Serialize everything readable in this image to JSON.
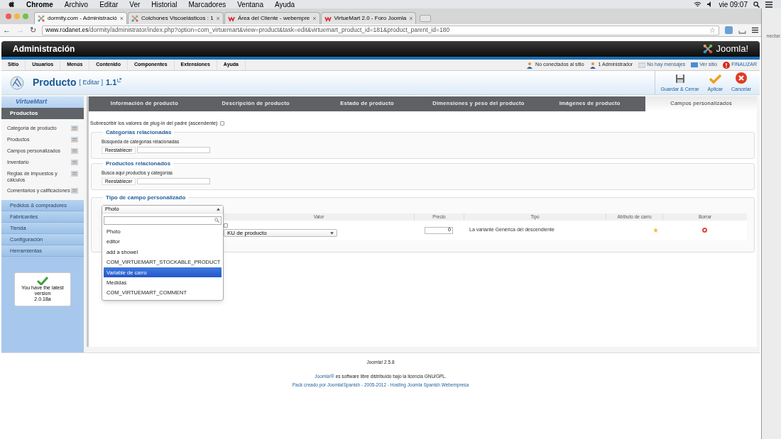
{
  "menubar": {
    "app": "Chrome",
    "menus": [
      "Archivo",
      "Editar",
      "Ver",
      "Historial",
      "Marcadores",
      "Ventana",
      "Ayuda"
    ],
    "clock": "vie 09:07"
  },
  "browser": {
    "tabs": [
      {
        "title": "dormity.com - Administració",
        "kind": "joomla",
        "selected": true
      },
      {
        "title": "Colchones Viscoelásticos : 1",
        "kind": "joomla",
        "selected": false
      },
      {
        "title": "Área del Cliente - webempre",
        "kind": "webempresa",
        "selected": false
      },
      {
        "title": "VirtueMart 2.0 - Foro Joomla",
        "kind": "webempresa",
        "selected": false
      }
    ],
    "close_glyph": "×",
    "nav": {
      "back": "←",
      "forward": "→",
      "reload": "↻",
      "bookmark": "☆"
    },
    "url_host": "www.rodanet.es",
    "url_path": "/dormity/administrator/index.php?option=com_virtuemart&view=product&task=edit&virtuemart_product_id=181&product_parent_id=180",
    "side_window_text": "nectar"
  },
  "header": {
    "title": "Administración",
    "logo": "Joomla!"
  },
  "admin_menu": [
    "Sitio",
    "Usuarios",
    "Menús",
    "Contenido",
    "Componentes",
    "Extensiones",
    "Ayuda"
  ],
  "status": [
    {
      "kind": "users",
      "label": "No conectados al sitio"
    },
    {
      "kind": "users",
      "label": "1 Administrador"
    },
    {
      "kind": "mail",
      "label": "No hay mensajes"
    },
    {
      "kind": "screen",
      "label": "Ver sitio"
    },
    {
      "kind": "alert",
      "label": "FINALIZAR"
    }
  ],
  "toolbar": {
    "title": "Producto",
    "edit": "[ Editar ]",
    "version": "1.1",
    "buttons": [
      {
        "kind": "save",
        "label": "Guardar & Cerrar"
      },
      {
        "kind": "apply",
        "label": "Aplicar"
      },
      {
        "kind": "cancel",
        "label": "Cancelar"
      }
    ]
  },
  "sidebar": {
    "logo": "VirtueMart",
    "section": "Productos",
    "items": [
      "Categoría de producto",
      "Productos",
      "Campos personalizados",
      "Inventario",
      "Reglas de impuestos y cálculos",
      "Comentarios y calificaciones"
    ],
    "groups": [
      "Pedidos & compradores",
      "Fabricantes",
      "Tienda",
      "Configuración",
      "Herramientas"
    ],
    "version_box": {
      "text": "You have the latest version",
      "version": "2.0.18a"
    }
  },
  "tabs": [
    {
      "label": "Información de producto",
      "selected": false
    },
    {
      "label": "Descripción de producto",
      "selected": false
    },
    {
      "label": "Estado de producto",
      "selected": false
    },
    {
      "label": "Dimensiones y peso del producto",
      "selected": false
    },
    {
      "label": "Imágenes de producto",
      "selected": false
    },
    {
      "label": "Campos personalizados",
      "selected": true
    }
  ],
  "override": {
    "label": "Sobrescribir los valores de plug-in del padre (ascendente)",
    "checked": false
  },
  "related": [
    {
      "legend": "Categorías relacionadas",
      "hint": "Búsqueda de categorías relacionadas",
      "button": "Reestablecer"
    },
    {
      "legend": "Productos relacionados",
      "hint": "Busca aquí productos y categorías",
      "button": "Reestablecer"
    }
  ],
  "custom_type": {
    "legend": "Tipo de campo personalizado",
    "select_value": "Photo",
    "options": [
      {
        "label": "Photo",
        "selected": false
      },
      {
        "label": "editor",
        "selected": false
      },
      {
        "label": "add a showel",
        "selected": false
      },
      {
        "label": "COM_VIRTUEMART_STOCKABLE_PRODUCT",
        "selected": false
      },
      {
        "label": "Variable de carro",
        "selected": true
      },
      {
        "label": "Medidas",
        "selected": false
      },
      {
        "label": "COM_VIRTUEMART_COMMENT",
        "selected": false
      }
    ],
    "columns": [
      "Valor",
      "Precio",
      "Tipo",
      "Atributo de carro",
      "Borrar"
    ],
    "rows": [
      {
        "checked": false,
        "value": "KU de producto",
        "price": "0",
        "type": "La variante Genérica del descendiente",
        "cart_attribute": true
      }
    ]
  },
  "footer": {
    "version": "Joomla! 2.5.8",
    "license_link": "Joomla!®",
    "license": "es software libre distribuido bajo la licencia GNU/GPL.",
    "credits": "Pack creado por Joomla!Spanish - 2005-2012 - Hosting Joomla Spanish Webempresa"
  }
}
